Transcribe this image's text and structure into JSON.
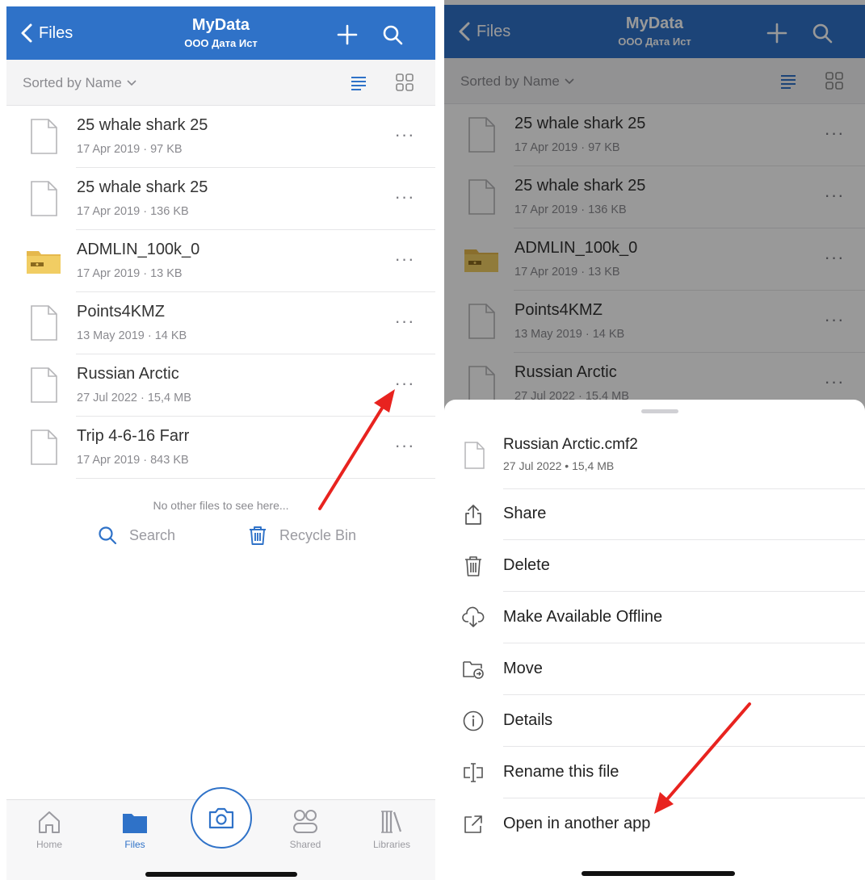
{
  "nav": {
    "back_label": "Files",
    "title": "MyData",
    "subtitle": "ООО Дата Ист"
  },
  "sort": {
    "label": "Sorted by Name"
  },
  "files": [
    {
      "name": "25 whale shark 25",
      "meta": "17 Apr 2019 · 97 KB",
      "icon": "document-icon"
    },
    {
      "name": "25 whale shark 25",
      "meta": "17 Apr 2019 · 136 KB",
      "icon": "document-icon"
    },
    {
      "name": "ADMLIN_100k_0",
      "meta": "17 Apr 2019 · 13 KB",
      "icon": "zip-folder-icon"
    },
    {
      "name": "Points4KMZ",
      "meta": "13 May 2019 · 14 KB",
      "icon": "document-icon"
    },
    {
      "name": "Russian Arctic",
      "meta": "27 Jul 2022 · 15,4 MB",
      "icon": "document-icon"
    },
    {
      "name": "Trip 4-6-16 Farr",
      "meta": "17 Apr 2019 · 843 KB",
      "icon": "document-icon"
    }
  ],
  "more_glyph": "···",
  "empty_note": "No other files to see here...",
  "actions": {
    "search": "Search",
    "recycle_bin": "Recycle Bin"
  },
  "tabs": [
    {
      "label": "Home",
      "icon": "home-icon",
      "active": false
    },
    {
      "label": "Files",
      "icon": "folder-icon",
      "active": true
    },
    {
      "label": "Shared",
      "icon": "shared-icon",
      "active": false
    },
    {
      "label": "Libraries",
      "icon": "libraries-icon",
      "active": false
    }
  ],
  "sheet": {
    "file_name": "Russian Arctic.cmf2",
    "file_meta": "27 Jul 2022 • 15,4 MB",
    "items": [
      {
        "label": "Share",
        "icon": "share-icon"
      },
      {
        "label": "Delete",
        "icon": "trash-icon"
      },
      {
        "label": "Make Available Offline",
        "icon": "cloud-download-icon"
      },
      {
        "label": "Move",
        "icon": "move-folder-icon"
      },
      {
        "label": "Details",
        "icon": "info-icon"
      },
      {
        "label": "Rename this file",
        "icon": "rename-icon"
      },
      {
        "label": "Open in another app",
        "icon": "external-open-icon"
      }
    ]
  },
  "colors": {
    "brand": "#2f72c8",
    "annotation_arrow": "#e8231f"
  }
}
